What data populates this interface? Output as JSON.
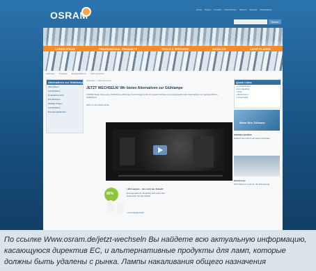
{
  "screenshot": {
    "logo": "OSRAM",
    "top_links": [
      "Home",
      "Presse",
      "Kontakt",
      "Unternehmen",
      "Karriere",
      "Sitemap",
      "Deutschland"
    ],
    "search": {
      "value": "",
      "button_label": "Suche"
    },
    "nav_items": [
      "LOREM IPSUM",
      "PROFESSIONAL PRODUKTE",
      "TOOLS & SERVICES",
      "KATALOG",
      "LICHT PLANEN"
    ],
    "breadcrumbs": [
      "Startseite",
      "Produkte",
      "Energieeffizienz",
      "Jetzt wechseln"
    ],
    "left_col": {
      "heading": "Alternativen zur Glühlampe",
      "items": [
        "Alternativen",
        "Zur Richtlinie",
        "Produktübersicht",
        "Zur Richtlinie",
        "Häufige Fragen",
        "Zur Richtlinie",
        "Energiesparlampen"
      ]
    },
    "main": {
      "crumb": "Startseite > Jetzt wechseln",
      "title": "JETZT WECHSELN! Wir bieten Alternativen zur Glühlampe",
      "paragraph": "OSRAM bietet Ihnen eine Vielzahl an effizienten Technologien und ein breites Sortiment an energiesparenden Alternativen zur herkömmlichen Glühlampe.",
      "link": "Mehr zu den Alternativen"
    },
    "video": {
      "progress_fraction": 0.0
    },
    "promo": {
      "badge": "85%",
      "title": "LED-Lampen – das Licht der Zukunft",
      "text": "Energiesparend, langlebig und sofort hell. Entdecken Sie die Vielfalt.",
      "link": "» Produktübersicht"
    },
    "right_col": {
      "heading": "Quick Links",
      "links": [
        "» Lampenfinder",
        "» Energielabel",
        "» FAQ",
        "» Broschüren",
        "» Downloads"
      ],
      "image_text": "Ideen fürs Zuhause",
      "section1_title": "OSRAM LichtWelt",
      "section1_text": "Erleben Sie Licht in all seinen Facetten.",
      "section2_title": "Global Care",
      "section2_text": "Informationen rund um die Entsorgung."
    }
  },
  "caption": "По ссылке Www.osram.de/jetzt-wechseln Вы найдете всю актуальную информацию, касающуюся директив ЕС, и альтернативные продукты для ламп, которые должны быть удалены с рынка. Лампы накаливания общего назначения"
}
